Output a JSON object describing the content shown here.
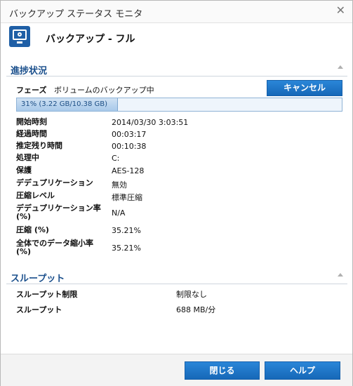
{
  "window": {
    "title": "バックアップ ステータス モニタ",
    "close_glyph": "✕"
  },
  "header": {
    "job_title": "バックアップ - フル"
  },
  "progress_section": {
    "label": "進捗状況",
    "phase_key": "フェーズ",
    "phase_value": "ボリュームのバックアップ中",
    "cancel_label": "キャンセル",
    "progress_text": "31% (3.22 GB/10.38 GB)",
    "progress_fraction": 0.31,
    "rows": [
      {
        "key": "開始時刻",
        "value": "2014/03/30 3:03:51"
      },
      {
        "key": "経過時間",
        "value": "00:03:17"
      },
      {
        "key": "推定残り時間",
        "value": "00:10:38"
      },
      {
        "key": "処理中",
        "value": "C:"
      },
      {
        "key": "保護",
        "value": "AES-128"
      },
      {
        "key": "デデュプリケーション",
        "value": "無効"
      },
      {
        "key": "圧縮レベル",
        "value": "標準圧縮"
      },
      {
        "key": "デデュプリケーション率 (%)",
        "value": "N/A"
      },
      {
        "key": "圧縮 (%)",
        "value": "35.21%"
      },
      {
        "key": "全体でのデータ縮小率 (%)",
        "value": "35.21%"
      }
    ]
  },
  "throughput_section": {
    "label": "スループット",
    "rows": [
      {
        "key": "スループット制限",
        "value": "制限なし"
      },
      {
        "key": "スループット",
        "value": "688 MB/分"
      }
    ]
  },
  "footer": {
    "close_label": "閉じる",
    "help_label": "ヘルプ"
  },
  "colors": {
    "accent": "#1a6fc4",
    "section_title": "#1a4f8c"
  },
  "icons": {
    "header": "monitor-icon",
    "close": "close-icon",
    "collapse": "chevron-up-icon"
  }
}
